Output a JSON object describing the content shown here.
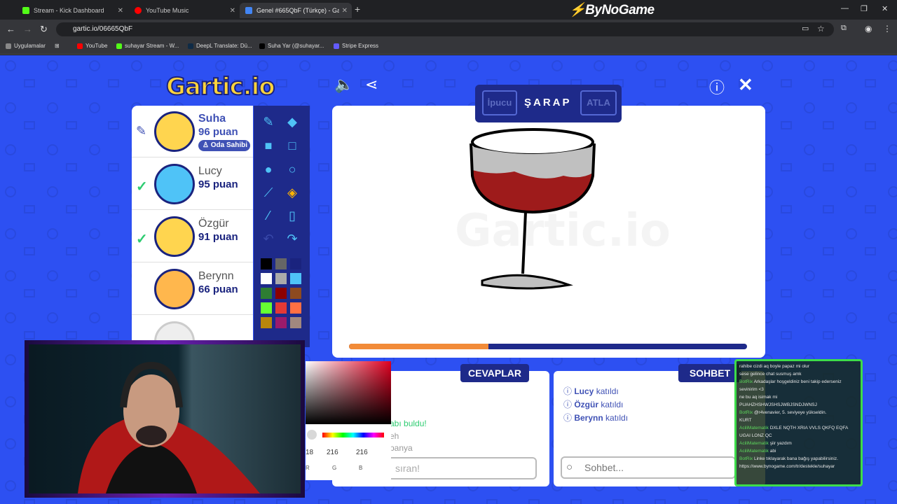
{
  "browser": {
    "tabs": [
      {
        "title": "Stream - Kick Dashboard",
        "icon_color": "#53fc18"
      },
      {
        "title": "YouTube Music",
        "icon_color": "#ff0000"
      },
      {
        "title": "Genel #665QbF (Türkçe) - Garti",
        "icon_color": "#4285f4"
      }
    ],
    "brand": "ByNoGame",
    "url": "gartic.io/06665QbF",
    "bookmarks": [
      {
        "label": "Uygulamalar",
        "color": "#888888"
      },
      {
        "label": "YouTube",
        "color": "#ff0000"
      },
      {
        "label": "suhayar Stream - W...",
        "color": "#53fc18"
      },
      {
        "label": "DeepL Translate: Dü...",
        "color": "#0f2b46"
      },
      {
        "label": "Suha Yar (@suhayar...",
        "color": "#000000"
      },
      {
        "label": "Stripe Express",
        "color": "#635bff"
      }
    ]
  },
  "game": {
    "logo": "Gartic.io",
    "hint_label": "İpucu",
    "word": "ŞARAP",
    "skip_label": "ATLA",
    "timer_fraction": 0.35,
    "players": [
      {
        "name": "Suha",
        "points": "96 puan",
        "badge": "Oda Sahibi"
      },
      {
        "name": "Lucy",
        "points": "95 puan"
      },
      {
        "name": "Özgür",
        "points": "91 puan"
      },
      {
        "name": "Berynn",
        "points": "66 puan"
      }
    ],
    "answers_title": "CEVAPLAR",
    "chat_title": "SOHBET",
    "answers_messages": [
      {
        "text": "abı buldu!",
        "color": "#2ecc71"
      },
      {
        "text": "eh",
        "color": "#999999"
      },
      {
        "text": "panya",
        "color": "#999999"
      }
    ],
    "answer_placeholder": "sıran!",
    "chat_placeholder": "Sohbet...",
    "joins": [
      {
        "name": "Lucy",
        "suffix": "katıldı"
      },
      {
        "name": "Özgür",
        "suffix": "katıldı"
      },
      {
        "name": "Berynn",
        "suffix": "katıldı"
      }
    ],
    "picker": {
      "r": "18",
      "g": "216",
      "b": "216",
      "r_label": "R",
      "g_label": "G",
      "b_label": "B"
    },
    "palette": [
      "#000000",
      "#666666",
      "#1a237e",
      "#ffffff",
      "#aaaaaa",
      "#4fc3f7",
      "#2e7d32",
      "#8b0000",
      "#8d4a1f",
      "#66ff33",
      "#e53935",
      "#ff7043",
      "#b8860b",
      "#9c1b6b",
      "#a1887f"
    ]
  },
  "stream_chat": [
    {
      "user": "",
      "text": "rahibe cizdi aq boyle papaz mi olur"
    },
    {
      "user": "",
      "text": "sese gelince chat susmuş amk"
    },
    {
      "user": "BotRix",
      "text": "Arkadaşlar hoşgeldiniz beni takip ederseniz sevinirim <3"
    },
    {
      "user": "",
      "text": "ne bu aq isimak mi"
    },
    {
      "user": "",
      "text": "PUAHZHSHWJSHSJWBJSNDJWNSJ"
    },
    {
      "user": "BotRix",
      "text": "@r4venavier, 5. seviyeye yükseldin."
    },
    {
      "user": "",
      "text": "KURT"
    },
    {
      "user": "AciliMatematik",
      "text": "DXLE NQTH XRIA VVLS QKFQ EQFA UGAI LONZ QC"
    },
    {
      "user": "AciliMatematik",
      "text": "şiir yazdım"
    },
    {
      "user": "AciliMatematik",
      "text": "abi"
    },
    {
      "user": "BotRix",
      "text": "Linke tıklayarak bana bağış yapabilirsiniz. https://www.bynogame.com/tr/destekle/suhayar"
    }
  ]
}
